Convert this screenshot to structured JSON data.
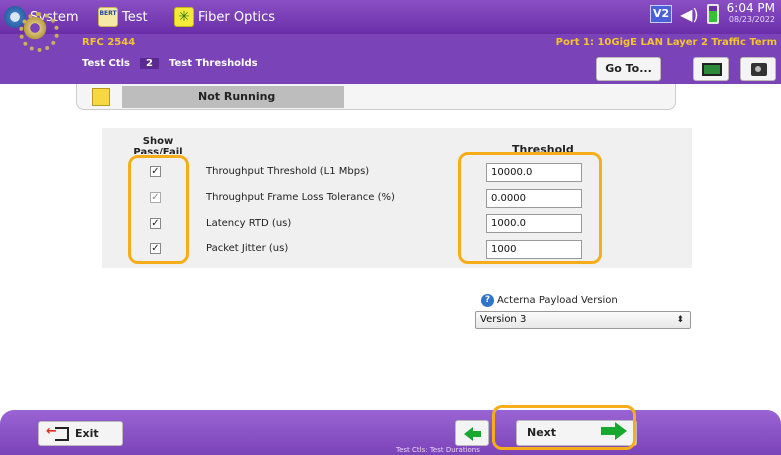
{
  "topbar": {
    "system_label": "System",
    "test_label": "Test",
    "test_icon_text": "BERT",
    "fiber_label": "Fiber Optics",
    "v2_label": "V2",
    "time": "6:04 PM",
    "date": "08/23/2022"
  },
  "header": {
    "rfc": "RFC 2544",
    "port": "Port 1: 10GigE LAN Layer 2 Traffic Term",
    "crumb_test_ctls": "Test Ctls",
    "crumb_num": "2",
    "crumb_page": "Test Thresholds",
    "goto_label": "Go To..."
  },
  "status": {
    "state": "Not Running"
  },
  "table": {
    "col_show": "Show Pass/Fail",
    "col_threshold": "Threshold",
    "rows": [
      {
        "label": "Throughput Threshold (L1 Mbps)",
        "value": "10000.0",
        "checked": "✓"
      },
      {
        "label": "Throughput Frame Loss Tolerance (%)",
        "value": "0.0000",
        "checked": "✓"
      },
      {
        "label": "Latency RTD (us)",
        "value": "1000.0",
        "checked": "✓"
      },
      {
        "label": "Packet Jitter (us)",
        "value": "1000",
        "checked": "✓"
      }
    ]
  },
  "payload": {
    "help_glyph": "?",
    "label": "Acterna Payload Version",
    "selected": "Version 3",
    "arrow": "⬍"
  },
  "footer": {
    "exit_label": "Exit",
    "next_label": "Next",
    "next_hint": "Test Ctls: Test Durations"
  },
  "colors": {
    "accent_purple": "#7b43b8",
    "highlight_orange": "#f5ae1a",
    "rfc_yellow": "#f4c430",
    "arrow_green": "#18a830"
  }
}
